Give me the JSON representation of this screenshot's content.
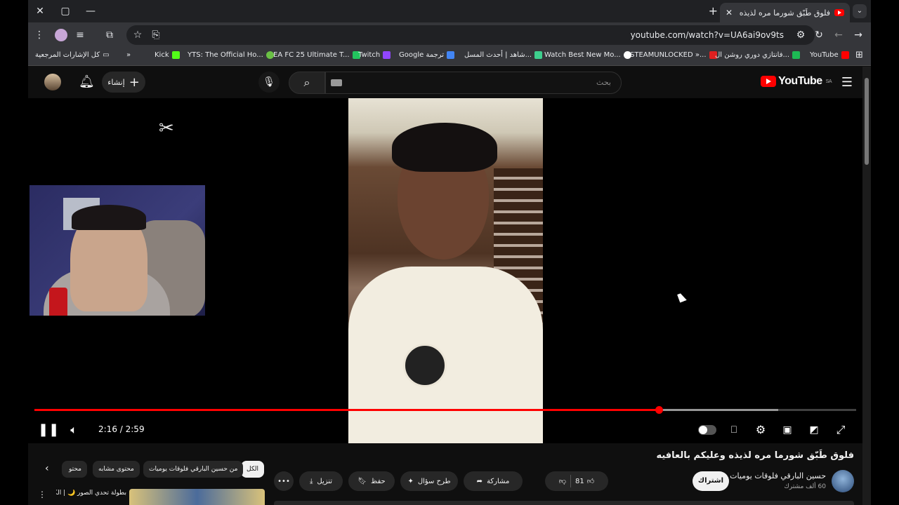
{
  "browser": {
    "tab_title": "فلوق طَبّق شورما مره لذيذه وعليكم بالعافيه",
    "url": "youtube.com/watch?v=UA6ai9ov9ts",
    "new_tab_symbol": "+",
    "bookmarks": [
      {
        "label": "YouTube",
        "color": "#ff0000"
      },
      {
        "label": "فانتازي دوري روشن ال...",
        "color": "#1db954"
      },
      {
        "label": "STEAMUNLOCKED »...",
        "color": "#e02020"
      },
      {
        "label": "Watch Best New Mo...",
        "color": "#ffffff"
      },
      {
        "label": "شاهد | أحدث المسل...",
        "color": "#3ecf8e"
      },
      {
        "label": "Google ترجمة",
        "color": "#4285f4"
      },
      {
        "label": "Twitch",
        "color": "#9146ff"
      },
      {
        "label": "EA FC 25 Ultimate T...",
        "color": "#22c55e"
      },
      {
        "label": "YTS: The Official Ho...",
        "color": "#6ac045"
      },
      {
        "label": "Kick",
        "color": "#53fc18"
      }
    ],
    "all_bookmarks": "كل الإشارات المرجعية"
  },
  "masthead": {
    "create_label": "إنشاء",
    "search_placeholder": "بحث",
    "logo_text": "YouTube",
    "region": "SA"
  },
  "player": {
    "current_time": "2:16",
    "duration": "2:59",
    "time_separator": " / ",
    "progress": 0.76,
    "buffered": 0.905,
    "capcut_glyph": "✂"
  },
  "video": {
    "title": "فلوق طَبّق شورما مره لذيذه وعليكم بالعافيه",
    "channel_name": "حسين البارقي فلوقات يوميات",
    "subscribers": "60 ألف مشترك",
    "subscribe_label": "اشتراك",
    "like_count": "81",
    "share_label": "مشاركة",
    "ask_label": "طرح سؤال",
    "save_label": "حفظ",
    "download_label": "تنزيل"
  },
  "related": {
    "chips": [
      "الكل",
      "من حسين البارقي فلوقات يوميات",
      "محتوى مشابه",
      "محتو"
    ],
    "first_title": "بطولة تحدي الصور 🌙 | الكبري..."
  },
  "colors": {
    "accent": "#ff0000",
    "background": "#0f0f0f",
    "chip": "#272727"
  }
}
